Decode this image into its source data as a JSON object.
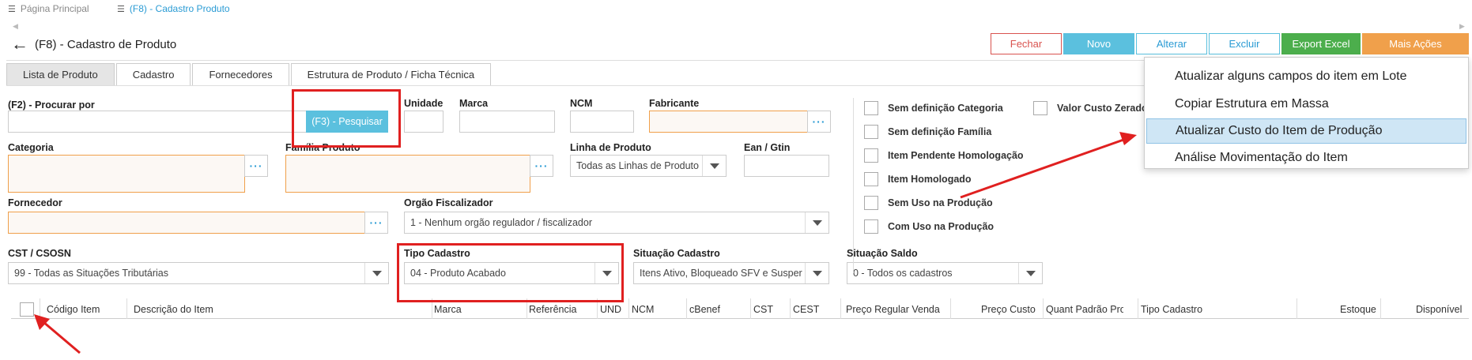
{
  "top_tabs": [
    {
      "label": "Página Principal",
      "icon": "list-icon"
    },
    {
      "label": "(F8) - Cadastro Produto",
      "icon": "list-icon"
    }
  ],
  "header": {
    "title": "(F8) - Cadastro de Produto",
    "buttons": {
      "fechar": "Fechar",
      "novo": "Novo",
      "alterar": "Alterar",
      "excluir": "Excluir",
      "export": "Export Excel",
      "mais": "Mais Ações"
    }
  },
  "tabs": [
    "Lista de Produto",
    "Cadastro",
    "Fornecedores",
    "Estrutura de Produto / Ficha Técnica"
  ],
  "filters": {
    "procurar_label": "(F2) - Procurar por",
    "pesquisar_button": "(F3) - Pesquisar",
    "unidade_label": "Unidade",
    "marca_label": "Marca",
    "ncm_label": "NCM",
    "fabricante_label": "Fabricante",
    "categoria_label": "Categoria",
    "familia_label": "Família Produto",
    "linha_label": "Linha de Produto",
    "linha_value": "Todas as Linhas de Produto",
    "ean_label": "Ean / Gtin",
    "fornecedor_label": "Fornecedor",
    "orgao_label": "Orgão Fiscalizador",
    "orgao_value": "1 - Nenhum orgão regulador / fiscalizador",
    "cst_label": "CST / CSOSN",
    "cst_value": "99 - Todas as Situações Tributárias",
    "tipo_label": "Tipo Cadastro",
    "tipo_value": "04 - Produto Acabado",
    "situacao_label": "Situação Cadastro",
    "situacao_value": "Itens Ativo, Bloqueado SFV e Susper",
    "saldo_label": "Situação Saldo",
    "saldo_value": "0 - Todos os cadastros"
  },
  "checkboxes": [
    "Sem definição Categoria",
    "Sem definição Família",
    "Item Pendente Homologação",
    "Item Homologado",
    "Sem Uso na Produção",
    "Com Uso na Produção"
  ],
  "checkbox_valor": "Valor Custo Zerado",
  "menu_items": [
    "Atualizar alguns campos do item em Lote",
    "Copiar Estrutura em Massa",
    "Atualizar Custo do Item de Produção",
    "Análise Movimentação do Item"
  ],
  "table_headers": [
    "Código Item",
    "Descrição do Item",
    "Marca",
    "Referência",
    "UND",
    "NCM",
    "cBenef",
    "CST",
    "CEST",
    "Preço Regular Venda",
    "Preço Custo",
    "Quant Padrão Proc",
    "Tipo Cadastro",
    "Estoque",
    "Disponível"
  ],
  "colors": {
    "accent": "#5bc0de",
    "danger": "#d9534f",
    "success": "#4cae4c",
    "warning": "#f0a04b",
    "annotation": "#e02020"
  }
}
